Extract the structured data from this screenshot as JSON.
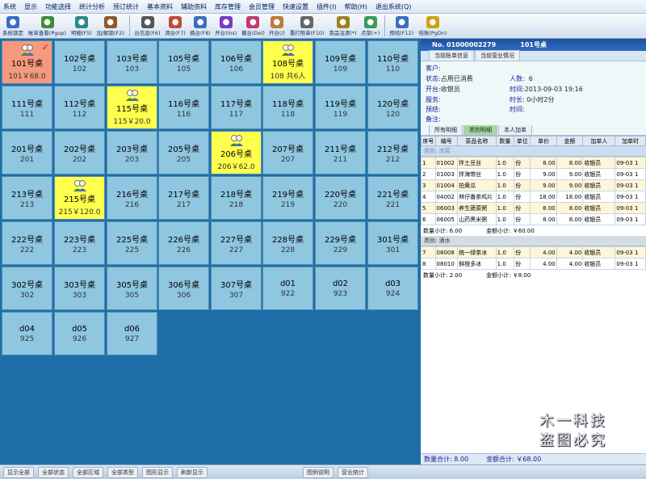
{
  "menu": [
    "系统",
    "显示",
    "功能选择",
    "统计分析",
    "预订统计",
    "基本资料",
    "辅助资料",
    "库存管理",
    "会员管理",
    "快速设置",
    "插件(I)",
    "帮助(H)",
    "退出系统(Q)"
  ],
  "toolbar": [
    {
      "label": "系统锁定",
      "color": "#3a6fc0"
    },
    {
      "label": "帐单查看(Pgup)",
      "color": "#3b8c3b"
    },
    {
      "label": "明细(F5)",
      "color": "#2b8a8a"
    },
    {
      "label": "加/解锁(F2)",
      "color": "#8c5a2b"
    },
    {
      "label": "台信息(F6)",
      "color": "#555"
    },
    {
      "label": "清台(F7)",
      "color": "#c04a3a"
    },
    {
      "label": "换台(F8)",
      "color": "#3a6fc0"
    },
    {
      "label": "开台(Ins)",
      "color": "#7a3ac0"
    },
    {
      "label": "撤台(Del)",
      "color": "#c03a6a"
    },
    {
      "label": "开台(/)",
      "color": "#c07a3a"
    },
    {
      "label": "重打照单(F10)",
      "color": "#666"
    },
    {
      "label": "菜品沽清(*)",
      "color": "#a08020"
    },
    {
      "label": "点菜(+)",
      "color": "#3a9a5a"
    },
    {
      "label": "预结(F12)",
      "color": "#3a6fc0"
    },
    {
      "label": "结账(PgDn)",
      "color": "#d0a010"
    }
  ],
  "tables": [
    {
      "name": "101号桌",
      "sub": "101￥68.0",
      "state": "sel",
      "check": "✓"
    },
    {
      "name": "102号桌",
      "sub": "102",
      "state": "free"
    },
    {
      "name": "103号桌",
      "sub": "103",
      "state": "free"
    },
    {
      "name": "105号桌",
      "sub": "105",
      "state": "free"
    },
    {
      "name": "106号桌",
      "sub": "106",
      "state": "free"
    },
    {
      "name": "108号桌",
      "sub": "108 共6人",
      "state": "occ"
    },
    {
      "name": "109号桌",
      "sub": "109",
      "state": "free"
    },
    {
      "name": "110号桌",
      "sub": "110",
      "state": "free"
    },
    {
      "name": "111号桌",
      "sub": "111",
      "state": "free"
    },
    {
      "name": "112号桌",
      "sub": "112",
      "state": "free"
    },
    {
      "name": "115号桌",
      "sub": "115￥20.0",
      "state": "occ"
    },
    {
      "name": "116号桌",
      "sub": "116",
      "state": "free"
    },
    {
      "name": "117号桌",
      "sub": "117",
      "state": "free"
    },
    {
      "name": "118号桌",
      "sub": "118",
      "state": "free"
    },
    {
      "name": "119号桌",
      "sub": "119",
      "state": "free"
    },
    {
      "name": "120号桌",
      "sub": "120",
      "state": "free"
    },
    {
      "name": "201号桌",
      "sub": "201",
      "state": "free"
    },
    {
      "name": "202号桌",
      "sub": "202",
      "state": "free"
    },
    {
      "name": "203号桌",
      "sub": "203",
      "state": "free"
    },
    {
      "name": "205号桌",
      "sub": "205",
      "state": "free"
    },
    {
      "name": "206号桌",
      "sub": "206￥62.0",
      "state": "occ"
    },
    {
      "name": "207号桌",
      "sub": "207",
      "state": "free"
    },
    {
      "name": "211号桌",
      "sub": "211",
      "state": "free"
    },
    {
      "name": "212号桌",
      "sub": "212",
      "state": "free"
    },
    {
      "name": "213号桌",
      "sub": "213",
      "state": "free"
    },
    {
      "name": "215号桌",
      "sub": "215￥120.0",
      "state": "occ"
    },
    {
      "name": "216号桌",
      "sub": "216",
      "state": "free"
    },
    {
      "name": "217号桌",
      "sub": "217",
      "state": "free"
    },
    {
      "name": "218号桌",
      "sub": "218",
      "state": "free"
    },
    {
      "name": "219号桌",
      "sub": "219",
      "state": "free"
    },
    {
      "name": "220号桌",
      "sub": "220",
      "state": "free"
    },
    {
      "name": "221号桌",
      "sub": "221",
      "state": "free"
    },
    {
      "name": "222号桌",
      "sub": "222",
      "state": "free"
    },
    {
      "name": "223号桌",
      "sub": "223",
      "state": "free"
    },
    {
      "name": "225号桌",
      "sub": "225",
      "state": "free"
    },
    {
      "name": "226号桌",
      "sub": "226",
      "state": "free"
    },
    {
      "name": "227号桌",
      "sub": "227",
      "state": "free"
    },
    {
      "name": "228号桌",
      "sub": "228",
      "state": "free"
    },
    {
      "name": "229号桌",
      "sub": "229",
      "state": "free"
    },
    {
      "name": "301号桌",
      "sub": "301",
      "state": "free"
    },
    {
      "name": "302号桌",
      "sub": "302",
      "state": "free"
    },
    {
      "name": "303号桌",
      "sub": "303",
      "state": "free"
    },
    {
      "name": "305号桌",
      "sub": "305",
      "state": "free"
    },
    {
      "name": "306号桌",
      "sub": "306",
      "state": "free"
    },
    {
      "name": "307号桌",
      "sub": "307",
      "state": "free"
    },
    {
      "name": "d01",
      "sub": "922",
      "state": "free"
    },
    {
      "name": "d02",
      "sub": "923",
      "state": "free"
    },
    {
      "name": "d03",
      "sub": "924",
      "state": "free"
    },
    {
      "name": "d04",
      "sub": "925",
      "state": "free"
    },
    {
      "name": "d05",
      "sub": "926",
      "state": "free"
    },
    {
      "name": "d06",
      "sub": "927",
      "state": "free"
    }
  ],
  "panel": {
    "bill_no": "No. 01000002279",
    "table_name": "101号桌",
    "tabs_top": [
      "当前账单信息",
      "当前营业情况"
    ],
    "info": {
      "customer_k": "客户:",
      "status_k": "状态:",
      "status_v": "占用已消费",
      "people_k": "人数:",
      "people_v": "6",
      "opener_k": "开台:",
      "opener_v": "收银员",
      "time_k": "时间:",
      "time_v": "2013-09-03 19:16",
      "waiter_k": "服务:",
      "duration_k": "时长:",
      "duration_v": "0小时2分",
      "booked_k": "预结:",
      "usage_k": "时间:",
      "note_k": "备注:"
    },
    "tabs_detail": [
      "所有明细",
      "类别明细",
      "本人加单"
    ],
    "columns": [
      "序号",
      "编号",
      "菜品名称",
      "数量",
      "单位",
      "单价",
      "金额",
      "加单人",
      "加单时"
    ],
    "groups": [
      {
        "category": "类别:   凉菜",
        "rows": [
          [
            "1",
            "01002",
            "拌土豆丝",
            "1.0",
            "份",
            "8.00",
            "8.00",
            "收银员",
            "09-03 1"
          ],
          [
            "2",
            "01003",
            "拌海带丝",
            "1.0",
            "份",
            "9.00",
            "9.00",
            "收银员",
            "09-03 1"
          ],
          [
            "3",
            "01004",
            "拍黄瓜",
            "1.0",
            "份",
            "9.00",
            "9.00",
            "收银员",
            "09-03 1"
          ],
          [
            "4",
            "04002",
            "林仔番茶鸡片",
            "1.0",
            "份",
            "18.00",
            "18.00",
            "收银员",
            "09-03 1"
          ],
          [
            "5",
            "06003",
            "养生蔬菜粥",
            "1.0",
            "份",
            "8.00",
            "8.00",
            "收银员",
            "09-03 1"
          ],
          [
            "6",
            "06005",
            "山药黑米粥",
            "1.0",
            "份",
            "8.00",
            "8.00",
            "收银员",
            "09-03 1"
          ]
        ],
        "qty_sum": "数量小计:  6.00",
        "amt_sum": "金额小计:    ￥60.00"
      },
      {
        "category": "类别:   酒水",
        "rows": [
          [
            "7",
            "08008",
            "统一绿茶冰",
            "1.0",
            "份",
            "4.00",
            "4.00",
            "收银员",
            "09-03 1"
          ],
          [
            "8",
            "08010",
            "鲜橙多冰",
            "1.0",
            "份",
            "4.00",
            "4.00",
            "收银员",
            "09-03 1"
          ]
        ],
        "qty_sum": "数量小计:  2.00",
        "amt_sum": "金额小计:    ￥8.00"
      }
    ],
    "foot_qty": "数量合计:      8.00",
    "foot_amt": "金额合计:     ￥68.00"
  },
  "bottom": [
    "显示全部",
    "全部状态",
    "全部区域",
    "全部类型",
    "图形显示",
    "刷新显示",
    "图例说明",
    "营业统计"
  ],
  "watermark": [
    "木一科技",
    "盗图必究"
  ]
}
